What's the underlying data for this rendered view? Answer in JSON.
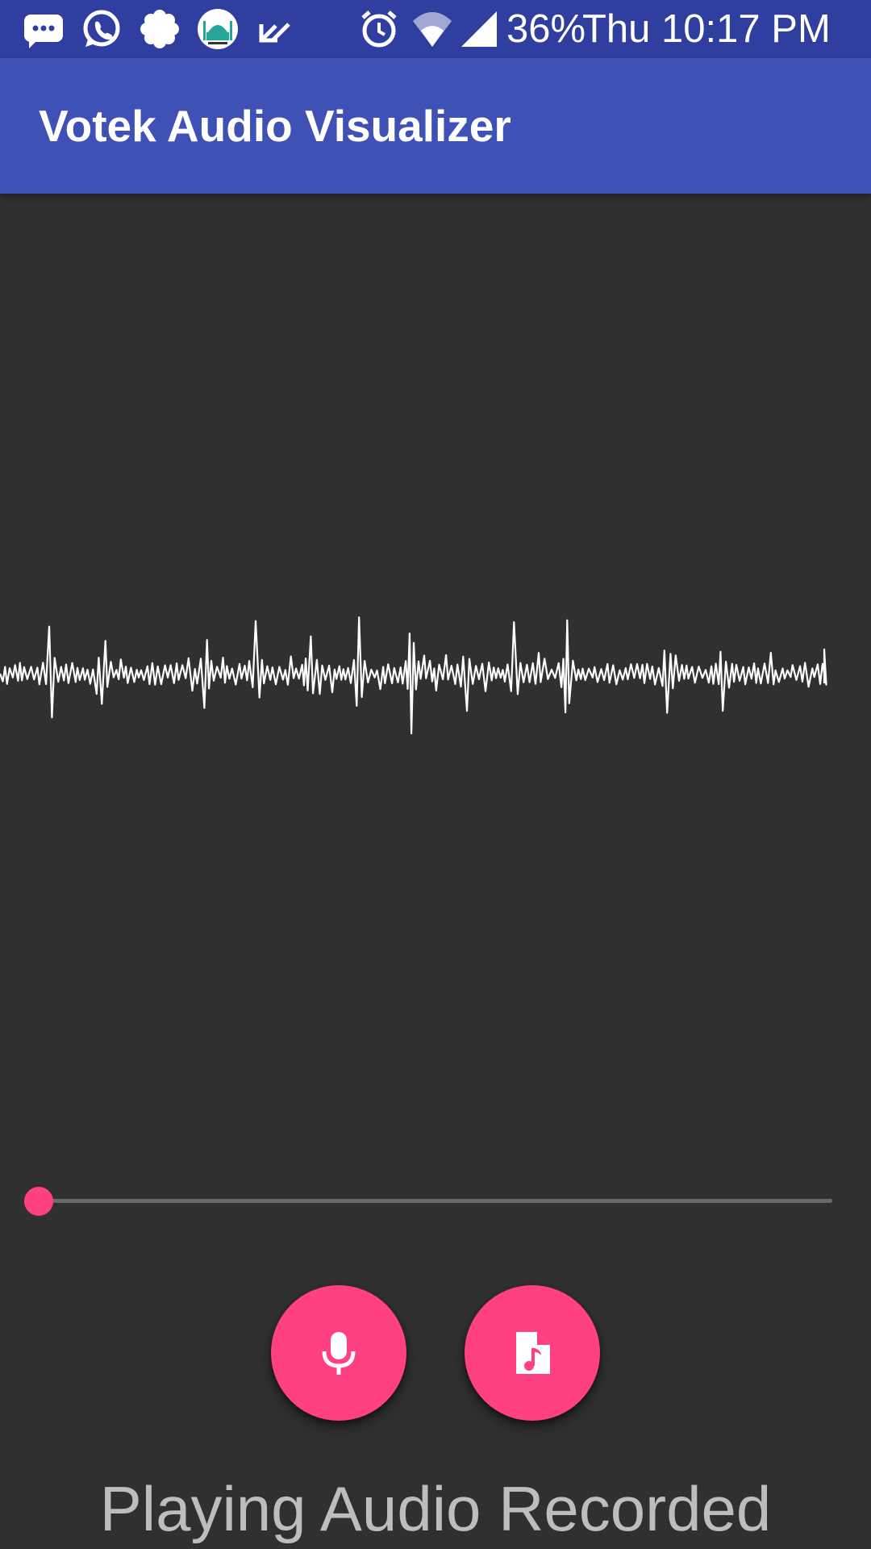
{
  "status_bar": {
    "notification_icons": [
      "message-icon",
      "whatsapp-icon",
      "settings-flower-icon",
      "mosque-app-icon",
      "check-download-icon"
    ],
    "system_icons": [
      "alarm-icon",
      "wifi-icon",
      "cell-signal-icon"
    ],
    "battery": "36%",
    "time": "Thu 10:17 PM"
  },
  "app_bar": {
    "title": "Votek Audio Visualizer"
  },
  "player": {
    "progress": 0,
    "record_icon": "microphone-icon",
    "file_icon": "audio-file-icon"
  },
  "status": {
    "text": "Playing Audio Recorded"
  },
  "colors": {
    "status_bar": "#303F9F",
    "app_bar": "#3F51B5",
    "background": "#303030",
    "accent": "#FF4081",
    "waveform": "#FFFFFF",
    "status_text": "#BDBDBD"
  }
}
